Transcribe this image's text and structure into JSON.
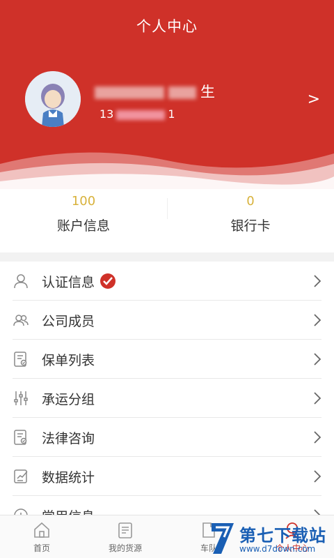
{
  "header": {
    "title": "个人中心"
  },
  "profile": {
    "name_visible": "生",
    "phone_prefix": "13",
    "phone_suffix": "1",
    "arrow": ">"
  },
  "stats": [
    {
      "value": "100",
      "label": "账户信息"
    },
    {
      "value": "0",
      "label": "银行卡"
    }
  ],
  "menu": [
    {
      "label": "认证信息",
      "icon": "person-icon"
    },
    {
      "label": "公司成员",
      "icon": "members-icon"
    },
    {
      "label": "保单列表",
      "icon": "policy-icon"
    },
    {
      "label": "承运分组",
      "icon": "sliders-icon"
    },
    {
      "label": "法律咨询",
      "icon": "legal-icon"
    },
    {
      "label": "数据统计",
      "icon": "stats-icon"
    },
    {
      "label": "常用信息",
      "icon": "info-icon"
    }
  ],
  "tabbar": [
    {
      "label": "首页",
      "icon": "home-icon"
    },
    {
      "label": "我的货源",
      "icon": "clipboard-icon"
    },
    {
      "label": "车队",
      "icon": "document-icon"
    },
    {
      "label": "个人中心",
      "icon": "user-icon"
    }
  ],
  "watermark": {
    "title": "第七下载站",
    "url": "www.d7down.com"
  },
  "colors": {
    "primary": "#cf3129",
    "stat_value": "#d8b23c",
    "watermark": "#1a5fb4"
  }
}
